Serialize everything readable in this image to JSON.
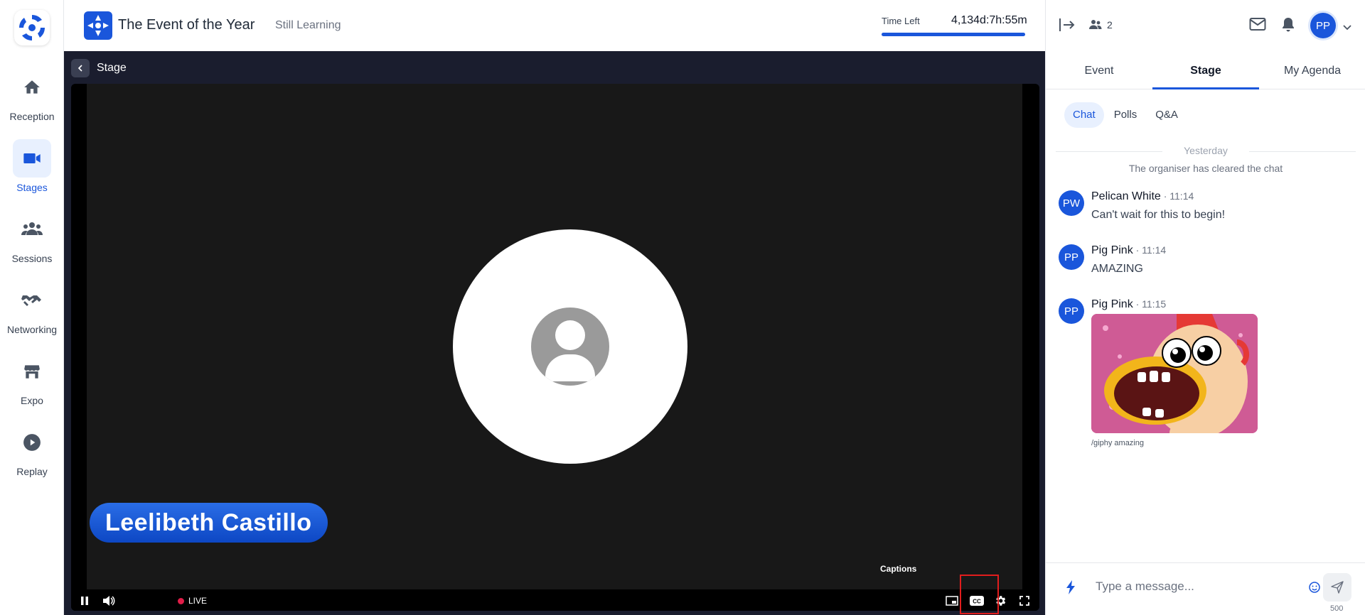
{
  "nav": {
    "items": [
      {
        "label": "Reception",
        "icon": "home-icon"
      },
      {
        "label": "Stages",
        "icon": "video-camera-icon",
        "active": true
      },
      {
        "label": "Sessions",
        "icon": "people-icon"
      },
      {
        "label": "Networking",
        "icon": "handshake-icon"
      },
      {
        "label": "Expo",
        "icon": "store-icon"
      },
      {
        "label": "Replay",
        "icon": "play-circle-icon"
      }
    ]
  },
  "header": {
    "title": "The Event of the Year",
    "subtitle": "Still Learning",
    "time_left_label": "Time Left",
    "time_left_value": "4,134d:7h:55m",
    "time_left_progress": 1.0
  },
  "stage": {
    "title": "Stage",
    "speaker_name": "Leelibeth Castillo",
    "live_label": "LIVE",
    "tooltip": "Captions"
  },
  "right_panel": {
    "attendee_count": "2",
    "user_initials": "PP",
    "tabs": [
      "Event",
      "Stage",
      "My Agenda"
    ],
    "active_tab": "Stage",
    "subtabs": [
      "Chat",
      "Polls",
      "Q&A"
    ],
    "active_subtab": "Chat",
    "day_separator": "Yesterday",
    "system_message": "The organiser has cleared the chat",
    "messages": [
      {
        "initials": "PW",
        "name": "Pelican White",
        "time": " · 11:14",
        "text": "Can't wait for this to begin!"
      },
      {
        "initials": "PP",
        "name": "Pig Pink",
        "time": " · 11:14",
        "text": "AMAZING"
      },
      {
        "initials": "PP",
        "name": "Pig Pink",
        "time": " · 11:15",
        "gif_caption": "/giphy amazing"
      }
    ],
    "composer": {
      "placeholder": "Type a message...",
      "char_count": "500"
    }
  },
  "colors": {
    "accent": "#1a56db",
    "stage_bg": "#1a1d2e",
    "live_dot": "#e11d48",
    "highlight": "#e11d1d"
  }
}
